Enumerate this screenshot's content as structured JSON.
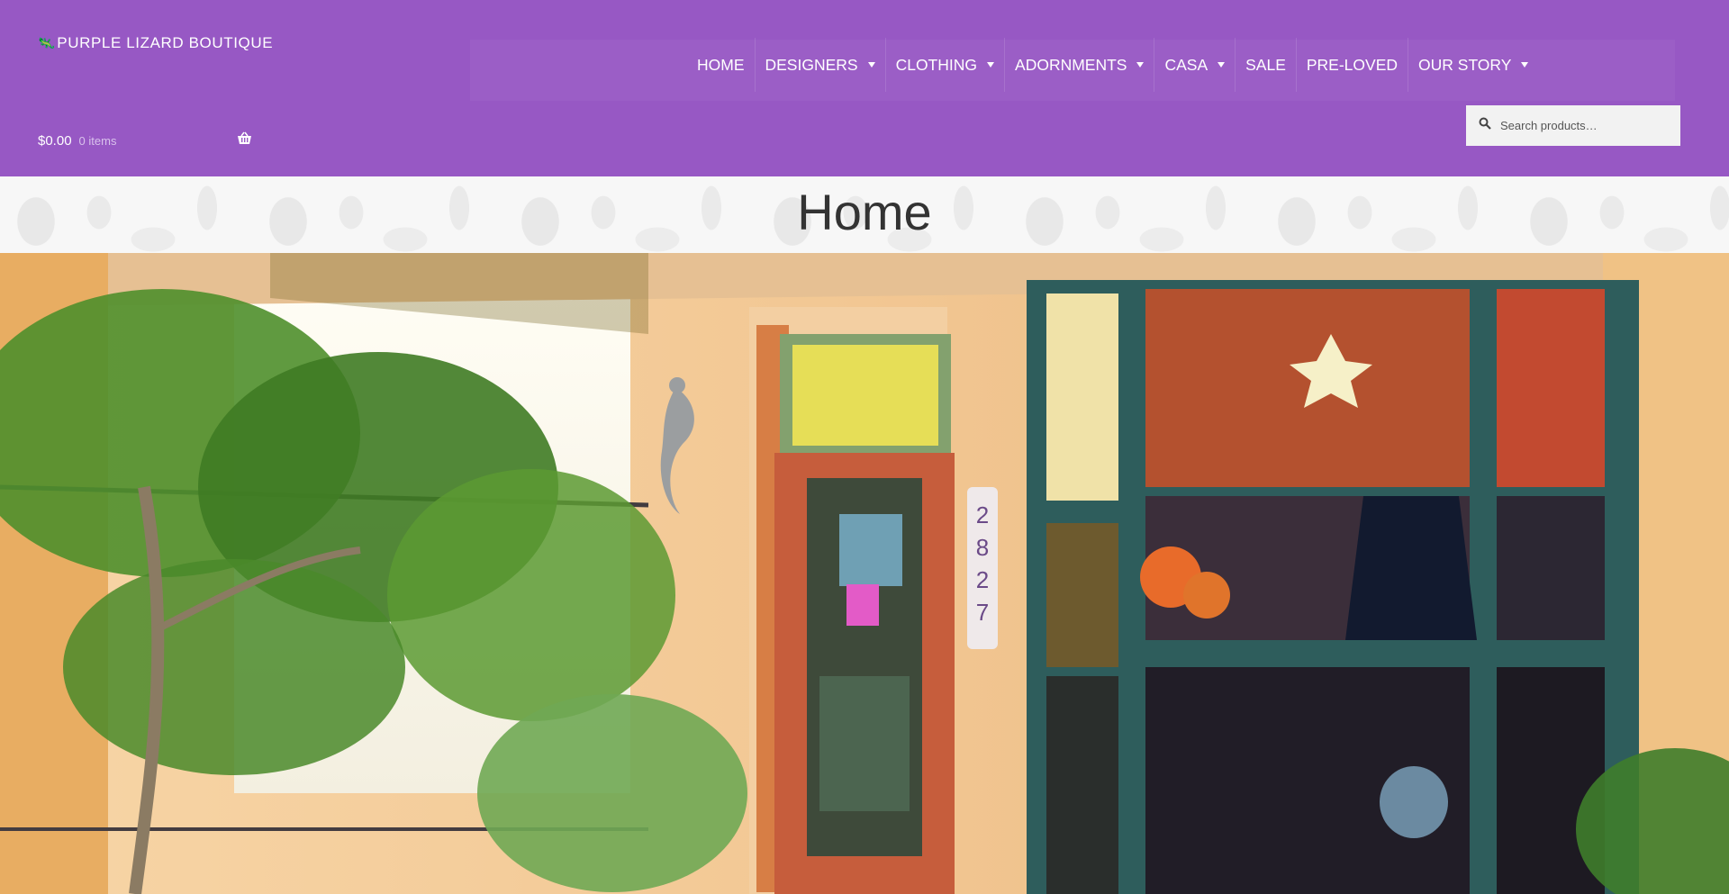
{
  "site": {
    "logo_text": "PURPLE LIZARD BOUTIQUE"
  },
  "nav": {
    "items": [
      {
        "label": "HOME",
        "has_submenu": false
      },
      {
        "label": "DESIGNERS",
        "has_submenu": true
      },
      {
        "label": "CLOTHING",
        "has_submenu": true
      },
      {
        "label": "ADORNMENTS",
        "has_submenu": true
      },
      {
        "label": "CASA",
        "has_submenu": true
      },
      {
        "label": "SALE",
        "has_submenu": false
      },
      {
        "label": "PRE-LOVED",
        "has_submenu": false
      },
      {
        "label": "OUR STORY",
        "has_submenu": true
      }
    ]
  },
  "cart": {
    "total": "$0.00",
    "count": "0 items",
    "icon": "basket-icon"
  },
  "search": {
    "placeholder": "Search products…",
    "icon": "search-icon"
  },
  "page": {
    "title": "Home"
  },
  "hero": {
    "address_number": "2827"
  },
  "colors": {
    "header_bg": "#9758c4",
    "title_band_bg": "#f7f7f7",
    "search_bg": "#f2f2f2"
  }
}
